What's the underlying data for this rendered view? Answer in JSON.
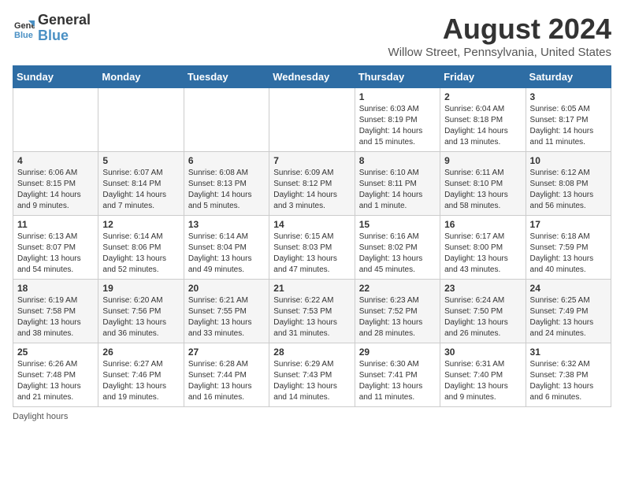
{
  "logo": {
    "line1": "General",
    "line2": "Blue"
  },
  "title": "August 2024",
  "location": "Willow Street, Pennsylvania, United States",
  "days_of_week": [
    "Sunday",
    "Monday",
    "Tuesday",
    "Wednesday",
    "Thursday",
    "Friday",
    "Saturday"
  ],
  "weeks": [
    [
      {
        "num": "",
        "info": ""
      },
      {
        "num": "",
        "info": ""
      },
      {
        "num": "",
        "info": ""
      },
      {
        "num": "",
        "info": ""
      },
      {
        "num": "1",
        "info": "Sunrise: 6:03 AM\nSunset: 8:19 PM\nDaylight: 14 hours\nand 15 minutes."
      },
      {
        "num": "2",
        "info": "Sunrise: 6:04 AM\nSunset: 8:18 PM\nDaylight: 14 hours\nand 13 minutes."
      },
      {
        "num": "3",
        "info": "Sunrise: 6:05 AM\nSunset: 8:17 PM\nDaylight: 14 hours\nand 11 minutes."
      }
    ],
    [
      {
        "num": "4",
        "info": "Sunrise: 6:06 AM\nSunset: 8:15 PM\nDaylight: 14 hours\nand 9 minutes."
      },
      {
        "num": "5",
        "info": "Sunrise: 6:07 AM\nSunset: 8:14 PM\nDaylight: 14 hours\nand 7 minutes."
      },
      {
        "num": "6",
        "info": "Sunrise: 6:08 AM\nSunset: 8:13 PM\nDaylight: 14 hours\nand 5 minutes."
      },
      {
        "num": "7",
        "info": "Sunrise: 6:09 AM\nSunset: 8:12 PM\nDaylight: 14 hours\nand 3 minutes."
      },
      {
        "num": "8",
        "info": "Sunrise: 6:10 AM\nSunset: 8:11 PM\nDaylight: 14 hours\nand 1 minute."
      },
      {
        "num": "9",
        "info": "Sunrise: 6:11 AM\nSunset: 8:10 PM\nDaylight: 13 hours\nand 58 minutes."
      },
      {
        "num": "10",
        "info": "Sunrise: 6:12 AM\nSunset: 8:08 PM\nDaylight: 13 hours\nand 56 minutes."
      }
    ],
    [
      {
        "num": "11",
        "info": "Sunrise: 6:13 AM\nSunset: 8:07 PM\nDaylight: 13 hours\nand 54 minutes."
      },
      {
        "num": "12",
        "info": "Sunrise: 6:14 AM\nSunset: 8:06 PM\nDaylight: 13 hours\nand 52 minutes."
      },
      {
        "num": "13",
        "info": "Sunrise: 6:14 AM\nSunset: 8:04 PM\nDaylight: 13 hours\nand 49 minutes."
      },
      {
        "num": "14",
        "info": "Sunrise: 6:15 AM\nSunset: 8:03 PM\nDaylight: 13 hours\nand 47 minutes."
      },
      {
        "num": "15",
        "info": "Sunrise: 6:16 AM\nSunset: 8:02 PM\nDaylight: 13 hours\nand 45 minutes."
      },
      {
        "num": "16",
        "info": "Sunrise: 6:17 AM\nSunset: 8:00 PM\nDaylight: 13 hours\nand 43 minutes."
      },
      {
        "num": "17",
        "info": "Sunrise: 6:18 AM\nSunset: 7:59 PM\nDaylight: 13 hours\nand 40 minutes."
      }
    ],
    [
      {
        "num": "18",
        "info": "Sunrise: 6:19 AM\nSunset: 7:58 PM\nDaylight: 13 hours\nand 38 minutes."
      },
      {
        "num": "19",
        "info": "Sunrise: 6:20 AM\nSunset: 7:56 PM\nDaylight: 13 hours\nand 36 minutes."
      },
      {
        "num": "20",
        "info": "Sunrise: 6:21 AM\nSunset: 7:55 PM\nDaylight: 13 hours\nand 33 minutes."
      },
      {
        "num": "21",
        "info": "Sunrise: 6:22 AM\nSunset: 7:53 PM\nDaylight: 13 hours\nand 31 minutes."
      },
      {
        "num": "22",
        "info": "Sunrise: 6:23 AM\nSunset: 7:52 PM\nDaylight: 13 hours\nand 28 minutes."
      },
      {
        "num": "23",
        "info": "Sunrise: 6:24 AM\nSunset: 7:50 PM\nDaylight: 13 hours\nand 26 minutes."
      },
      {
        "num": "24",
        "info": "Sunrise: 6:25 AM\nSunset: 7:49 PM\nDaylight: 13 hours\nand 24 minutes."
      }
    ],
    [
      {
        "num": "25",
        "info": "Sunrise: 6:26 AM\nSunset: 7:48 PM\nDaylight: 13 hours\nand 21 minutes."
      },
      {
        "num": "26",
        "info": "Sunrise: 6:27 AM\nSunset: 7:46 PM\nDaylight: 13 hours\nand 19 minutes."
      },
      {
        "num": "27",
        "info": "Sunrise: 6:28 AM\nSunset: 7:44 PM\nDaylight: 13 hours\nand 16 minutes."
      },
      {
        "num": "28",
        "info": "Sunrise: 6:29 AM\nSunset: 7:43 PM\nDaylight: 13 hours\nand 14 minutes."
      },
      {
        "num": "29",
        "info": "Sunrise: 6:30 AM\nSunset: 7:41 PM\nDaylight: 13 hours\nand 11 minutes."
      },
      {
        "num": "30",
        "info": "Sunrise: 6:31 AM\nSunset: 7:40 PM\nDaylight: 13 hours\nand 9 minutes."
      },
      {
        "num": "31",
        "info": "Sunrise: 6:32 AM\nSunset: 7:38 PM\nDaylight: 13 hours\nand 6 minutes."
      }
    ]
  ],
  "footer": "Daylight hours"
}
